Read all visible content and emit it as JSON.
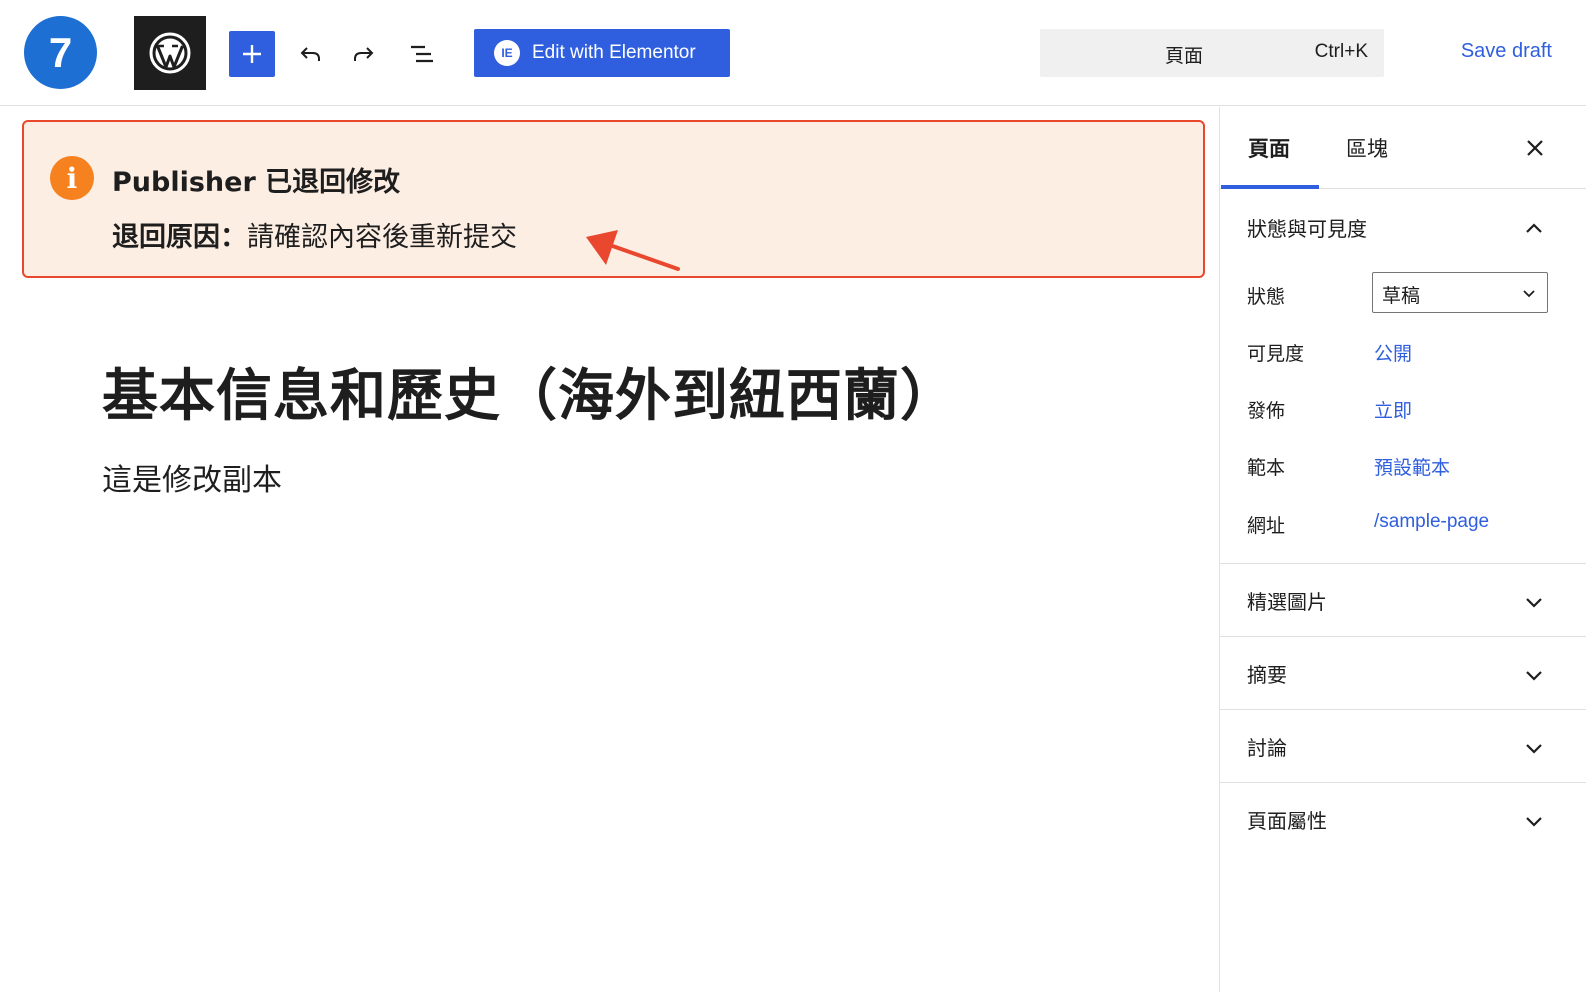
{
  "badge": {
    "step_number": "7"
  },
  "toolbar": {
    "elementor_label": "Edit with Elementor",
    "elementor_icon_text": "IE",
    "command_title": "頁面",
    "command_shortcut": "Ctrl+K",
    "save_draft_label": "Save draft"
  },
  "notice": {
    "icon_text": "i",
    "title": "Publisher 已退回修改",
    "reason_label": "退回原因：",
    "reason_text": "請確認內容後重新提交",
    "border_color": "#e9472e",
    "background_color": "#fdeee4"
  },
  "editor": {
    "title": "基本信息和歷史（海外到紐西蘭）",
    "body": "這是修改副本"
  },
  "sidebar": {
    "tabs": [
      {
        "label": "頁面",
        "active": true
      },
      {
        "label": "區塊",
        "active": false
      }
    ],
    "status_panel": {
      "title": "狀態與可見度",
      "expanded": true,
      "status_label": "狀態",
      "status_value": "草稿",
      "visibility_label": "可見度",
      "visibility_value": "公開",
      "publish_label": "發佈",
      "publish_value": "立即",
      "template_label": "範本",
      "template_value": "預設範本",
      "url_label": "網址",
      "url_value": "/sample-page"
    },
    "panels": [
      {
        "title": "精選圖片",
        "expanded": false
      },
      {
        "title": "摘要",
        "expanded": false
      },
      {
        "title": "討論",
        "expanded": false
      },
      {
        "title": "頁面屬性",
        "expanded": false
      }
    ]
  },
  "colors": {
    "accent": "#2f5fdf",
    "badge": "#1d6fd3",
    "info_icon": "#f5811f",
    "annotation_arrow": "#e9472e"
  },
  "icons": [
    "wordpress-logo",
    "plus-icon",
    "undo-icon",
    "redo-icon",
    "document-overview-icon",
    "elementor-icon",
    "info-icon",
    "close-icon",
    "chevron-up-icon",
    "chevron-down-icon"
  ]
}
